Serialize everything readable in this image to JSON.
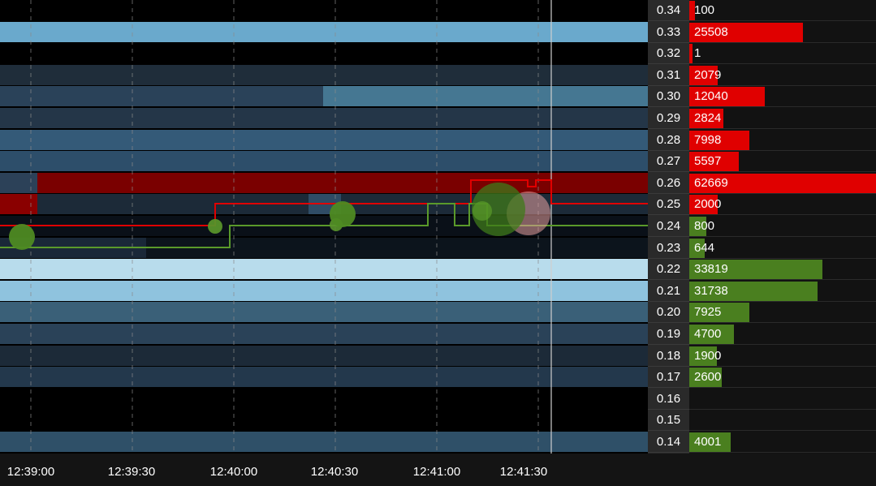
{
  "order_book": {
    "levels": [
      {
        "price": "0.34",
        "volume": "100",
        "side": "ask",
        "size": 100
      },
      {
        "price": "0.33",
        "volume": "25508",
        "side": "ask",
        "size": 25508
      },
      {
        "price": "0.32",
        "volume": "1",
        "side": "ask",
        "size": 1
      },
      {
        "price": "0.31",
        "volume": "2079",
        "side": "ask",
        "size": 2079
      },
      {
        "price": "0.30",
        "volume": "12040",
        "side": "ask",
        "size": 12040
      },
      {
        "price": "0.29",
        "volume": "2824",
        "side": "ask",
        "size": 2824
      },
      {
        "price": "0.28",
        "volume": "7998",
        "side": "ask",
        "size": 7998
      },
      {
        "price": "0.27",
        "volume": "5597",
        "side": "ask",
        "size": 5597
      },
      {
        "price": "0.26",
        "volume": "62669",
        "side": "ask",
        "size": 62669
      },
      {
        "price": "0.25",
        "volume": "2000",
        "side": "ask",
        "size": 2000
      },
      {
        "price": "0.24",
        "volume": "800",
        "side": "bid",
        "size": 800
      },
      {
        "price": "0.23",
        "volume": "644",
        "side": "bid",
        "size": 644
      },
      {
        "price": "0.22",
        "volume": "33819",
        "side": "bid",
        "size": 33819
      },
      {
        "price": "0.21",
        "volume": "31738",
        "side": "bid",
        "size": 31738
      },
      {
        "price": "0.20",
        "volume": "7925",
        "side": "bid",
        "size": 7925
      },
      {
        "price": "0.19",
        "volume": "4700",
        "side": "bid",
        "size": 4700
      },
      {
        "price": "0.18",
        "volume": "1900",
        "side": "bid",
        "size": 1900
      },
      {
        "price": "0.17",
        "volume": "2600",
        "side": "bid",
        "size": 2600
      },
      {
        "price": "0.16",
        "volume": "",
        "side": "bid",
        "size": 0
      },
      {
        "price": "0.15",
        "volume": "",
        "side": "bid",
        "size": 0
      },
      {
        "price": "0.14",
        "volume": "4001",
        "side": "bid",
        "size": 4001
      }
    ]
  },
  "time_axis": {
    "labels": [
      "12:39:00",
      "12:39:30",
      "12:40:00",
      "12:40:30",
      "12:41:00",
      "12:41:30"
    ]
  },
  "colors": {
    "ask": "#e00000",
    "bid": "#4a7f1f",
    "background": "#000000",
    "price_column": "#2a2a2a"
  }
}
